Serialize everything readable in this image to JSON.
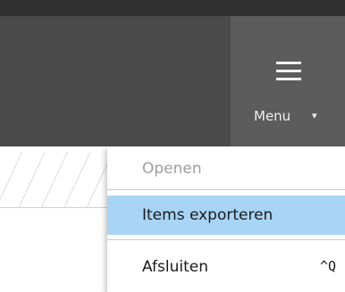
{
  "toolbar": {
    "menu_label": "Menu",
    "menu_caret": "▾",
    "menu_icon": "hamburger-icon"
  },
  "dropdown": {
    "items": [
      {
        "label": "Openen",
        "enabled": false,
        "highlighted": false,
        "shortcut": ""
      },
      {
        "label": "Items exporteren",
        "enabled": true,
        "highlighted": true,
        "shortcut": ""
      },
      {
        "label": "Afsluiten",
        "enabled": true,
        "highlighted": false,
        "shortcut": "^Q"
      }
    ]
  },
  "colors": {
    "top_bar": "#2f2f2f",
    "toolbar": "#4a4a4a",
    "menu_button": "#5c5c5c",
    "highlight": "#a8d4f5",
    "disabled_text": "#9e9e9e"
  }
}
